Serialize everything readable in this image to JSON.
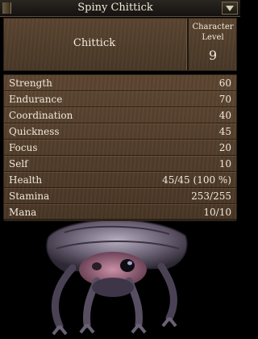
{
  "window": {
    "title": "Spiny Chittick",
    "close_icon": "chevron-down-icon"
  },
  "header": {
    "creature_type": "Chittick",
    "level_label": "Character Level",
    "level_value": "9"
  },
  "stats": [
    {
      "label": "Strength",
      "value": "60"
    },
    {
      "label": "Endurance",
      "value": "70"
    },
    {
      "label": "Coordination",
      "value": "40"
    },
    {
      "label": "Quickness",
      "value": "45"
    },
    {
      "label": "Focus",
      "value": "20"
    },
    {
      "label": "Self",
      "value": "10"
    },
    {
      "label": "Health",
      "value": "45/45 (100 %)"
    },
    {
      "label": "Stamina",
      "value": "253/255"
    },
    {
      "label": "Mana",
      "value": "10/10"
    }
  ],
  "colors": {
    "panel_brown": "#5a4530",
    "text": "#f0eadc",
    "background": "#000000"
  }
}
